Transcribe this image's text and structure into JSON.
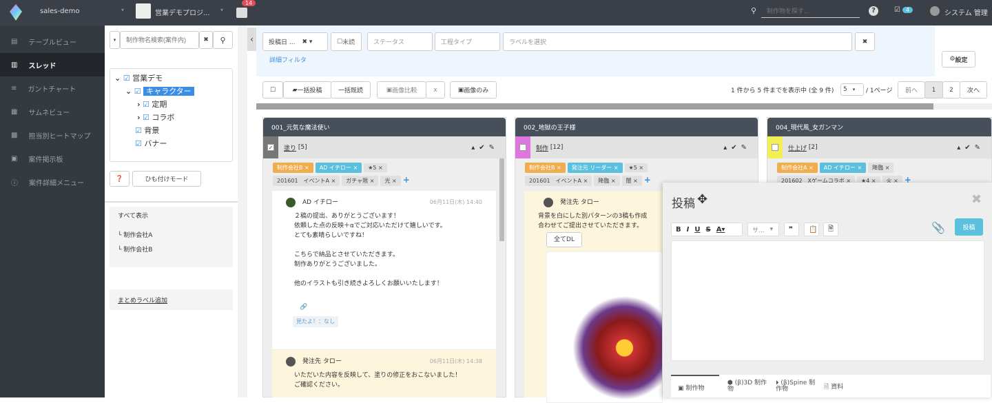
{
  "topbar": {
    "workspace": "sales-demo",
    "project": "営業デモプロジ...",
    "notification_count": "14",
    "search_placeholder": "制作物を探す...",
    "task_count": "4",
    "user": "システム 管理"
  },
  "sidebar": {
    "items": [
      {
        "label": "テーブルビュー",
        "icon": "table-icon"
      },
      {
        "label": "スレッド",
        "icon": "columns-icon",
        "active": true
      },
      {
        "label": "ガントチャート",
        "icon": "gantt-icon"
      },
      {
        "label": "サムネビュー",
        "icon": "grid-icon"
      },
      {
        "label": "担当別ヒートマップ",
        "icon": "heatmap-icon"
      },
      {
        "label": "案件掲示板",
        "icon": "board-icon"
      },
      {
        "label": "案件詳細メニュー",
        "icon": "info-icon"
      }
    ]
  },
  "left": {
    "search_placeholder": "制作物名検索(案件内)",
    "tree": [
      {
        "label": "営業デモ",
        "level": 0,
        "arrow": "⌄"
      },
      {
        "label": "キャラクター",
        "level": 1,
        "arrow": "⌄",
        "selected": true
      },
      {
        "label": "定期",
        "level": 2,
        "arrow": "›"
      },
      {
        "label": "コラボ",
        "level": 2,
        "arrow": "›"
      },
      {
        "label": "背景",
        "level": 1,
        "arrow": ""
      },
      {
        "label": "バナー",
        "level": 1,
        "arrow": ""
      }
    ],
    "link_mode": "ひも付けモード",
    "groups": {
      "all": "すべて表示",
      "items": [
        "制作会社A",
        "制作会社B"
      ]
    },
    "add_label": "まとめラベル追加"
  },
  "filter": {
    "date": "投稿日 ...",
    "unread": "未読",
    "status": "ステータス",
    "process": "工程タイプ",
    "label_placeholder": "ラベルを選択",
    "detail": "詳細フィルタ",
    "settings": "設定"
  },
  "toolbar": {
    "bulk_post": "一括投稿",
    "bulk_read": "一括既読",
    "compare": "画像比較",
    "compare_x": "x",
    "images_only": "画像のみ",
    "paging_info": "1 件から 5 件までを表示中 (全 9 件)",
    "per_page": "5",
    "pages_label": "/ 1ページ",
    "prev": "前へ",
    "pages": [
      "1",
      "2"
    ],
    "next": "次へ",
    "progress": 0.92
  },
  "columns": [
    {
      "title": "001_元気な魔法使い",
      "step": "塗り",
      "count": "[5]",
      "color": "#777",
      "checked": true,
      "tags": [
        [
          "制作会社B",
          "o"
        ],
        [
          "AD イチロー",
          "b"
        ],
        [
          "★5",
          ""
        ],
        [
          "201601　イベントA",
          ""
        ],
        [
          "ガチャ限",
          ""
        ],
        [
          "光",
          ""
        ]
      ]
    },
    {
      "title": "002_地獄の王子様",
      "step": "制作",
      "count": "[12]",
      "color": "#dd77dd",
      "tags": [
        [
          "制作会社B",
          "o"
        ],
        [
          "発注元 リーダー",
          "b"
        ],
        [
          "★5",
          ""
        ],
        [
          "201601　イベントA",
          ""
        ],
        [
          "降臨",
          ""
        ],
        [
          "闇",
          ""
        ]
      ]
    },
    {
      "title": "004_現代風_女ガンマン",
      "step": "仕上げ",
      "count": "[2]",
      "color": "#f2ee55",
      "tags": [
        [
          "制作会社A",
          "o"
        ],
        [
          "AD イチロー",
          "b"
        ],
        [
          "降臨",
          ""
        ],
        [
          "201602　Xゲームコラボ",
          ""
        ],
        [
          "★4",
          ""
        ],
        [
          "火",
          ""
        ]
      ]
    }
  ],
  "posts": {
    "c1p1": {
      "author": "AD イチロー",
      "time": "06月11日(木) 14:40",
      "lines": [
        "２稿の提出、ありがとうございます！",
        "依頼した点の反映＋αでご対応いただけて嬉しいです。",
        "とても素晴らしいですね！",
        "",
        "こちらで納品とさせていただきます。",
        "制作ありがとうございました。",
        "",
        "他のイラストも引き続きよろしくお願いいたします！"
      ],
      "seen": "見たよ！：なし"
    },
    "c1p2": {
      "author": "発注先 タロー",
      "time": "06月11日(木) 14:38",
      "lines": [
        "いただいた内容を反映して、塗りの修正をおこないました！",
        "ご確認ください。"
      ]
    },
    "c2p1": {
      "author": "発注先 タロー",
      "lines": [
        "背景を白にした別パターンの3稿も作成",
        "合わせてご提出させていただきます。"
      ],
      "download": "全てDL"
    }
  },
  "dialog": {
    "title": "投稿",
    "font": "サ...",
    "submit": "投稿",
    "tabs": [
      "制作物",
      "(β)3D 制作物",
      "(β)Spine 制作物",
      "資料"
    ]
  }
}
